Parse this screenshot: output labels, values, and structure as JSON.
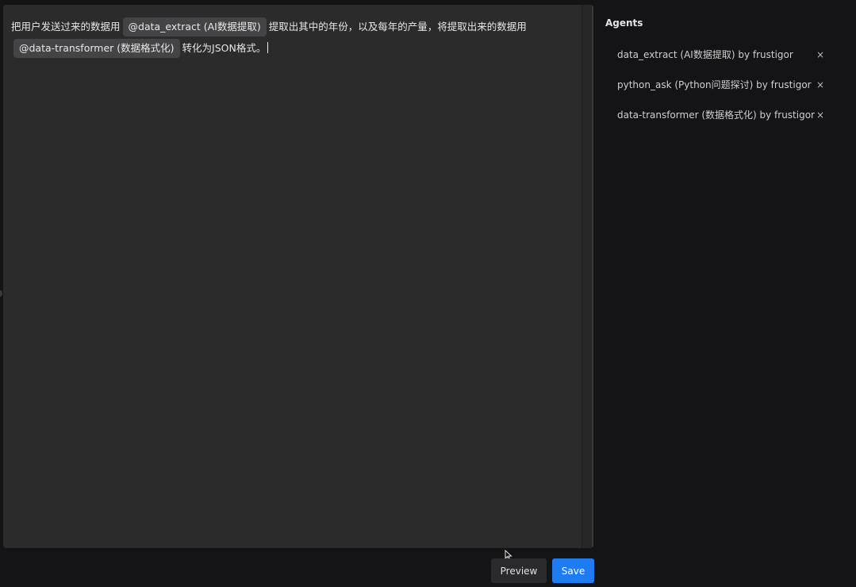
{
  "editor": {
    "segments": [
      {
        "type": "text",
        "text": "把用户发送过来的数据用"
      },
      {
        "type": "mention",
        "text": "@data_extract (AI数据提取)"
      },
      {
        "type": "text",
        "text": "提取出其中的年份，以及每年的产量，将提取出来的数据用"
      },
      {
        "type": "mention",
        "text": "@data-transformer (数据格式化)"
      },
      {
        "type": "text",
        "text": "转化为JSON格式。"
      }
    ]
  },
  "sidebar": {
    "title": "Agents",
    "items": [
      {
        "label": "data_extract (AI数据提取) by frustigor",
        "remove": "×"
      },
      {
        "label": "python_ask (Python问题探讨) by frustigor",
        "remove": "×"
      },
      {
        "label": "data-transformer (数据格式化) by frustigor",
        "remove": "×"
      }
    ]
  },
  "footer": {
    "preview_label": "Preview",
    "save_label": "Save"
  },
  "colors": {
    "accent": "#1f7cf0",
    "background": "#141416",
    "editor_background": "#2b2b2b",
    "mention_background": "#444446"
  }
}
